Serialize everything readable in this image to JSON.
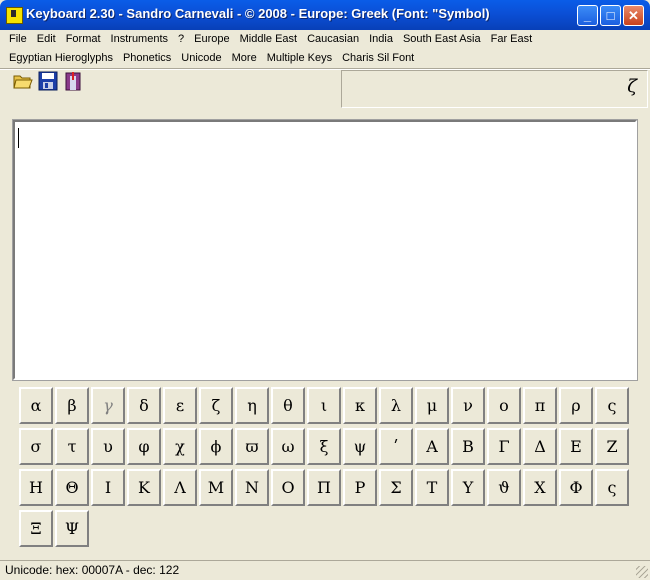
{
  "window": {
    "title": "Keyboard 2.30 - Sandro Carnevali - ©  2008 - Europe: Greek (Font: \"Symbol)",
    "buttons": {
      "minimize": "_",
      "maximize": "□",
      "close": "✕"
    }
  },
  "menu": {
    "row1": [
      "File",
      "Edit",
      "Format",
      "Instruments",
      "?",
      "Europe",
      "Middle East",
      "Caucasian",
      "India",
      "South East Asia",
      "Far East"
    ],
    "row2": [
      "Egyptian Hieroglyphs",
      "Phonetics",
      "Unicode",
      "More",
      "Multiple Keys",
      "Charis Sil Font"
    ]
  },
  "toolbar": {
    "icons": [
      "open-folder-icon",
      "save-disk-icon",
      "exit-door-icon"
    ]
  },
  "preview": {
    "char": "ζ"
  },
  "keys": {
    "rows": [
      [
        "α",
        "β",
        "γ",
        "δ",
        "ε",
        "ζ",
        "η",
        "θ",
        "ι",
        "κ",
        "λ",
        "μ",
        "ν",
        "ο",
        "π",
        "ρ",
        "ς"
      ],
      [
        "σ",
        "τ",
        "υ",
        "φ",
        "χ",
        "ϕ",
        "ϖ",
        "ω",
        "ξ",
        "ψ",
        "ʹ",
        "Α",
        "Β",
        "Γ",
        "Δ",
        "Ε",
        "Ζ"
      ],
      [
        "Η",
        "Θ",
        "Ι",
        "Κ",
        "Λ",
        "Μ",
        "Ν",
        "Ο",
        "Π",
        "Ρ",
        "Σ",
        "Τ",
        "Υ",
        "ϑ",
        "Χ",
        "Φ",
        "ς"
      ],
      [
        "Ξ",
        "Ψ"
      ]
    ]
  },
  "status": {
    "text": "Unicode: hex: 00007A - dec: 122"
  },
  "colors": {
    "title_bar": "#0b4fd6",
    "window_bg": "#ece9d8",
    "text_area_bg": "#ffffff"
  }
}
